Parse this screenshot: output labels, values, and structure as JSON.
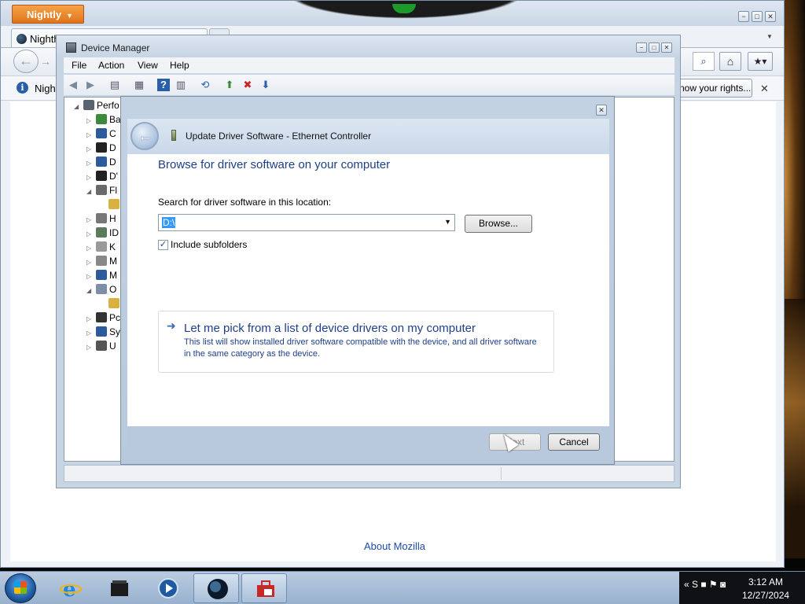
{
  "firefox": {
    "menu_button": "Nightly",
    "tab_title": "Nighth",
    "notification_text": "Night",
    "notification_button": "now your rights...",
    "notification_close": "✕",
    "content_link": "About Mozilla",
    "window_controls": [
      "−",
      "□",
      "✕"
    ]
  },
  "device_manager": {
    "title": "Device Manager",
    "menu": [
      "File",
      "Action",
      "View",
      "Help"
    ],
    "window_controls": [
      "−",
      "□",
      "✕"
    ],
    "tree": [
      {
        "text": "Perfo",
        "expander": "◢",
        "level": 0,
        "icon_color": "#5a6470"
      },
      {
        "text": "Ba",
        "expander": "▷",
        "level": 1,
        "icon_color": "#3d8a3d"
      },
      {
        "text": "C",
        "expander": "▷",
        "level": 1,
        "icon_color": "#2d5a9a"
      },
      {
        "text": "D",
        "expander": "▷",
        "level": 1,
        "icon_color": "#222"
      },
      {
        "text": "D",
        "expander": "▷",
        "level": 1,
        "icon_color": "#2d5a9a"
      },
      {
        "text": "D'",
        "expander": "▷",
        "level": 1,
        "icon_color": "#222"
      },
      {
        "text": "Fl",
        "expander": "◢",
        "level": 1,
        "icon_color": "#6a6a6a"
      },
      {
        "text": "",
        "expander": "",
        "level": 2,
        "icon_color": "#d8b240"
      },
      {
        "text": "H",
        "expander": "▷",
        "level": 1,
        "icon_color": "#777"
      },
      {
        "text": "ID",
        "expander": "▷",
        "level": 1,
        "icon_color": "#5c7a5c"
      },
      {
        "text": "K",
        "expander": "▷",
        "level": 1,
        "icon_color": "#999"
      },
      {
        "text": "M",
        "expander": "▷",
        "level": 1,
        "icon_color": "#888"
      },
      {
        "text": "M",
        "expander": "▷",
        "level": 1,
        "icon_color": "#2d5a9a"
      },
      {
        "text": "O",
        "expander": "◢",
        "level": 1,
        "icon_color": "#7d8fa6"
      },
      {
        "text": "",
        "expander": "",
        "level": 2,
        "icon_color": "#d8b240"
      },
      {
        "text": "Pc",
        "expander": "▷",
        "level": 1,
        "icon_color": "#333"
      },
      {
        "text": "Sy",
        "expander": "▷",
        "level": 1,
        "icon_color": "#2d5a9a"
      },
      {
        "text": "U",
        "expander": "▷",
        "level": 1,
        "icon_color": "#555"
      }
    ]
  },
  "update_driver": {
    "close": "✕",
    "back_glyph": "←",
    "header_title": "Update Driver Software - Ethernet Controller",
    "heading": "Browse for driver software on your computer",
    "search_label": "Search for driver software in this location:",
    "path_value": "D:\\",
    "browse_button": "Browse...",
    "include_subfolders_label": "Include subfolders",
    "include_subfolders_checked": true,
    "pick_title": "Let me pick from a list of device drivers on my computer",
    "pick_description": "This list will show installed driver software compatible with the device, and all driver software in the same category as the device.",
    "next_button": "Next",
    "cancel_button": "Cancel"
  },
  "taskbar": {
    "apps": [
      "internet-explorer",
      "device-toolbox",
      "media-player",
      "nightly-browser",
      "toolbox"
    ],
    "tray_icons": "« S ■ ⚑ ◙",
    "time": "3:12 AM",
    "date": "12/27/2024"
  }
}
